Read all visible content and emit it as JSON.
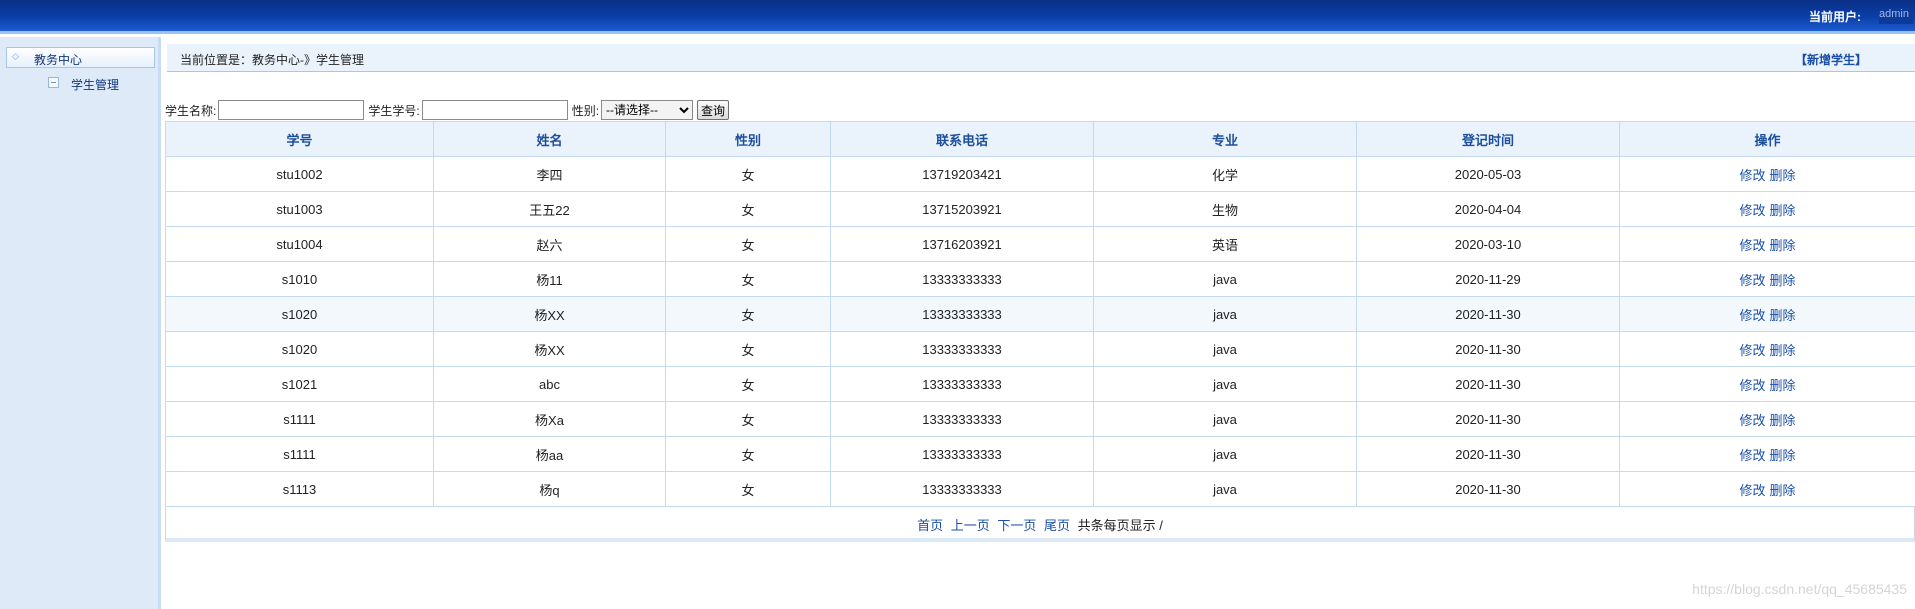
{
  "header": {
    "current_user_label": "当前用户:",
    "username": "admin"
  },
  "sidebar": {
    "group": {
      "label": "教务中心"
    },
    "items": [
      {
        "label": "学生管理"
      }
    ]
  },
  "breadcrumb": {
    "text": "当前位置是：教务中心-》学生管理",
    "add_link": "【新增学生】"
  },
  "search": {
    "name_label": "学生名称:",
    "name_value": "",
    "id_label": "学生学号:",
    "id_value": "",
    "gender_label": "性别:",
    "gender_selected": "--请选择--",
    "query_button": "查询"
  },
  "table": {
    "columns": [
      "学号",
      "姓名",
      "性别",
      "联系电话",
      "专业",
      "登记时间",
      "操作"
    ],
    "rows": [
      {
        "id": "stu1002",
        "name": "李四",
        "gender": "女",
        "phone": "13719203421",
        "major": "化学",
        "date": "2020-05-03"
      },
      {
        "id": "stu1003",
        "name": "王五22",
        "gender": "女",
        "phone": "13715203921",
        "major": "生物",
        "date": "2020-04-04"
      },
      {
        "id": "stu1004",
        "name": "赵六",
        "gender": "女",
        "phone": "13716203921",
        "major": "英语",
        "date": "2020-03-10"
      },
      {
        "id": "s1010",
        "name": "杨11",
        "gender": "女",
        "phone": "13333333333",
        "major": "java",
        "date": "2020-11-29"
      },
      {
        "id": "s1020",
        "name": "杨XX",
        "gender": "女",
        "phone": "13333333333",
        "major": "java",
        "date": "2020-11-30"
      },
      {
        "id": "s1020",
        "name": "杨XX",
        "gender": "女",
        "phone": "13333333333",
        "major": "java",
        "date": "2020-11-30"
      },
      {
        "id": "s1021",
        "name": "abc",
        "gender": "女",
        "phone": "13333333333",
        "major": "java",
        "date": "2020-11-30"
      },
      {
        "id": "s1111",
        "name": "杨Xa",
        "gender": "女",
        "phone": "13333333333",
        "major": "java",
        "date": "2020-11-30"
      },
      {
        "id": "s1111",
        "name": "杨aa",
        "gender": "女",
        "phone": "13333333333",
        "major": "java",
        "date": "2020-11-30"
      },
      {
        "id": "s1113",
        "name": "杨q",
        "gender": "女",
        "phone": "13333333333",
        "major": "java",
        "date": "2020-11-30"
      }
    ],
    "edit_label": "修改",
    "delete_label": "删除"
  },
  "pager": {
    "first": "首页",
    "prev": "上一页",
    "next": "下一页",
    "last": "尾页",
    "summary": "共条每页显示 /"
  },
  "watermark": "https://blog.csdn.net/qq_45685435"
}
